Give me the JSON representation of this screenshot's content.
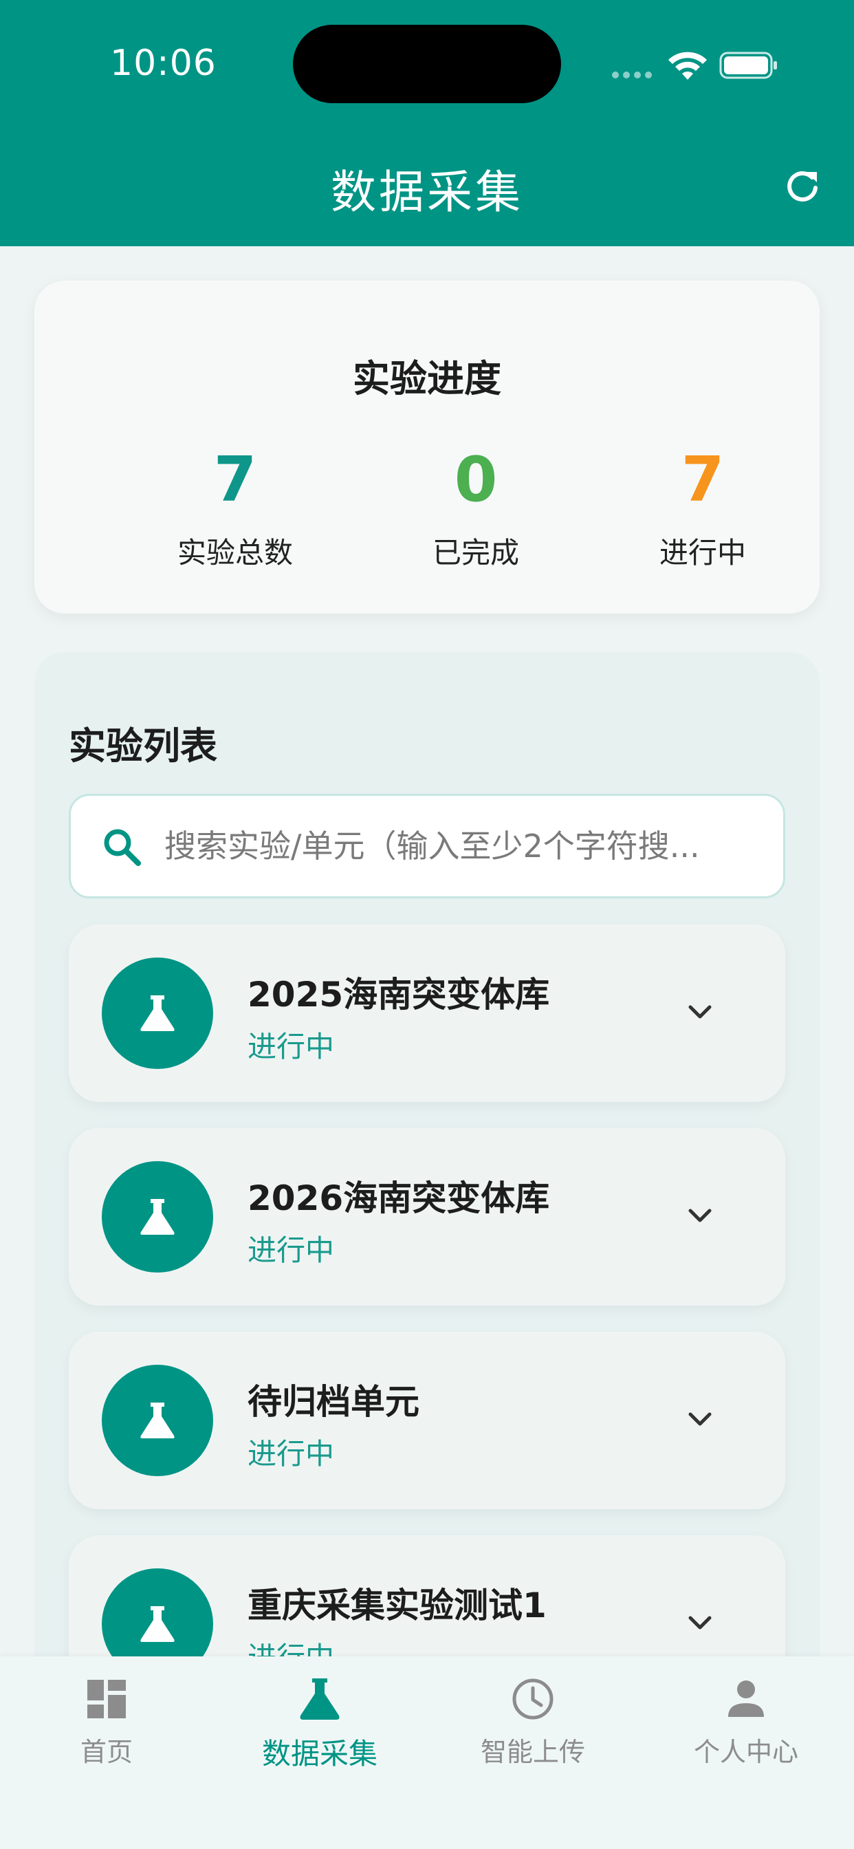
{
  "status_bar": {
    "time": "10:06"
  },
  "header": {
    "title": "数据采集"
  },
  "progress": {
    "title": "实验进度",
    "stats": [
      {
        "value": "7",
        "label": "实验总数",
        "color": "#0f968a"
      },
      {
        "value": "0",
        "label": "已完成",
        "color": "#4caf50"
      },
      {
        "value": "7",
        "label": "进行中",
        "color": "#f7941d"
      }
    ]
  },
  "list": {
    "title": "实验列表",
    "search_placeholder": "搜索实验/单元（输入至少2个字符搜...",
    "items": [
      {
        "name": "2025海南突变体库",
        "status": "进行中"
      },
      {
        "name": "2026海南突变体库",
        "status": "进行中"
      },
      {
        "name": "待归档单元",
        "status": "进行中"
      },
      {
        "name": "重庆采集实验测试1",
        "status": "进行中"
      }
    ]
  },
  "tabs": [
    {
      "label": "首页",
      "icon": "dashboard-icon",
      "active": false
    },
    {
      "label": "数据采集",
      "icon": "flask-icon",
      "active": true
    },
    {
      "label": "智能上传",
      "icon": "clock-icon",
      "active": false
    },
    {
      "label": "个人中心",
      "icon": "person-icon",
      "active": false
    }
  ],
  "colors": {
    "primary": "#009485",
    "completed": "#4caf50",
    "in_progress": "#f7941d"
  }
}
